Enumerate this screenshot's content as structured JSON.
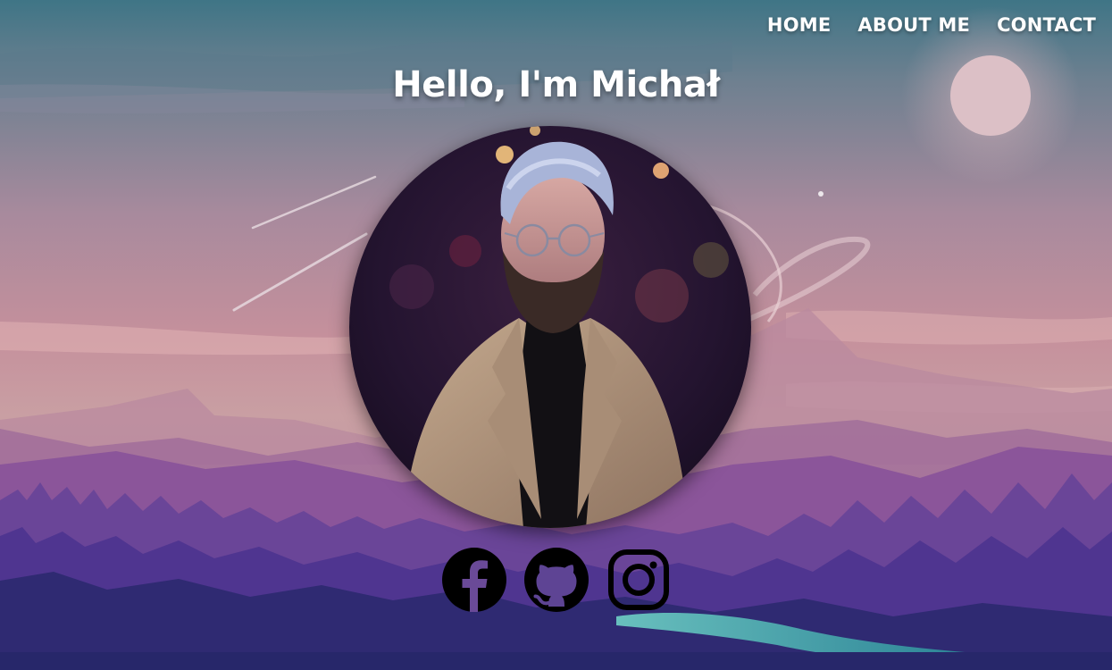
{
  "nav": {
    "items": [
      {
        "label": "HOME"
      },
      {
        "label": "ABOUT ME"
      },
      {
        "label": "CONTACT"
      }
    ]
  },
  "hero": {
    "title": "Hello, I'm Michał"
  },
  "portrait": {
    "alt_icon": "profile-photo"
  },
  "socials": [
    {
      "icon": "facebook-icon"
    },
    {
      "icon": "github-icon"
    },
    {
      "icon": "instagram-icon"
    }
  ],
  "colors": {
    "text": "#ffffff",
    "icon": "#000000",
    "sky_top": "#4f7f8c",
    "sky_mid": "#c28f9e",
    "forest": "#3a2a6e"
  }
}
